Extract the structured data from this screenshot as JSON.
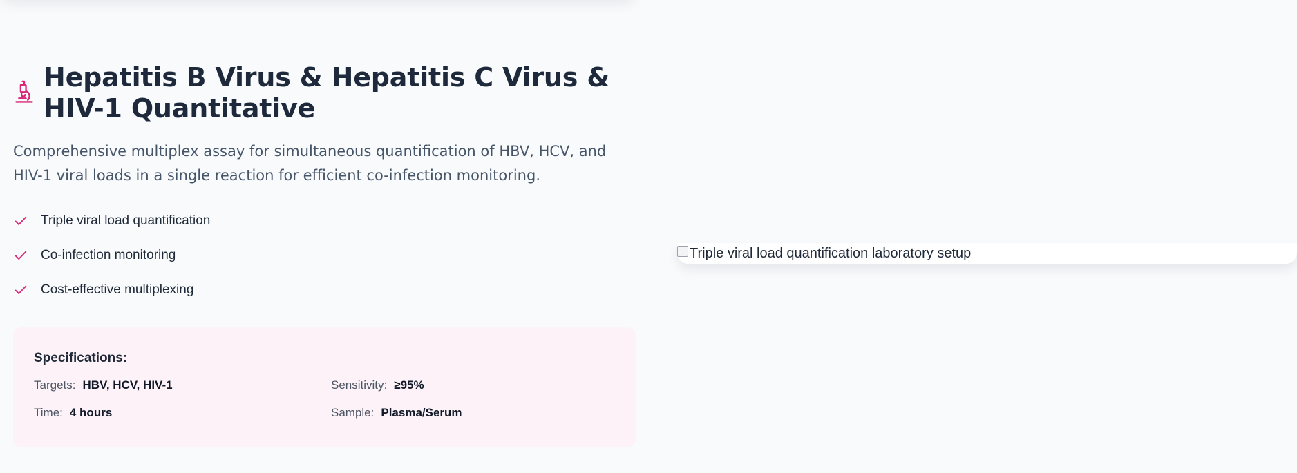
{
  "section": {
    "title": "Hepatitis B Virus & Hepatitis C Virus & HIV-1 Quantitative",
    "title_icon": "microscope-icon",
    "description": "Comprehensive multiplex assay for simultaneous quantification of HBV, HCV, and HIV-1 viral loads in a single reaction for efficient co-infection monitoring.",
    "features": [
      {
        "label": "Triple viral load quantification",
        "icon": "check-icon"
      },
      {
        "label": "Co-infection monitoring",
        "icon": "check-icon"
      },
      {
        "label": "Cost-effective multiplexing",
        "icon": "check-icon"
      }
    ],
    "specifications": {
      "heading": "Specifications:",
      "items": [
        {
          "label": "Targets:",
          "value": "HBV, HCV, HIV-1"
        },
        {
          "label": "Sensitivity:",
          "value": "≥95%"
        },
        {
          "label": "Time:",
          "value": "4 hours"
        },
        {
          "label": "Sample:",
          "value": "Plasma/Serum"
        }
      ]
    },
    "image": {
      "alt": "Triple viral load quantification laboratory setup"
    }
  },
  "colors": {
    "accent": "#db2777",
    "background": "#f8fafc",
    "spec_background": "#fdf2f7",
    "heading": "#1e293b",
    "body_text": "#475569"
  }
}
